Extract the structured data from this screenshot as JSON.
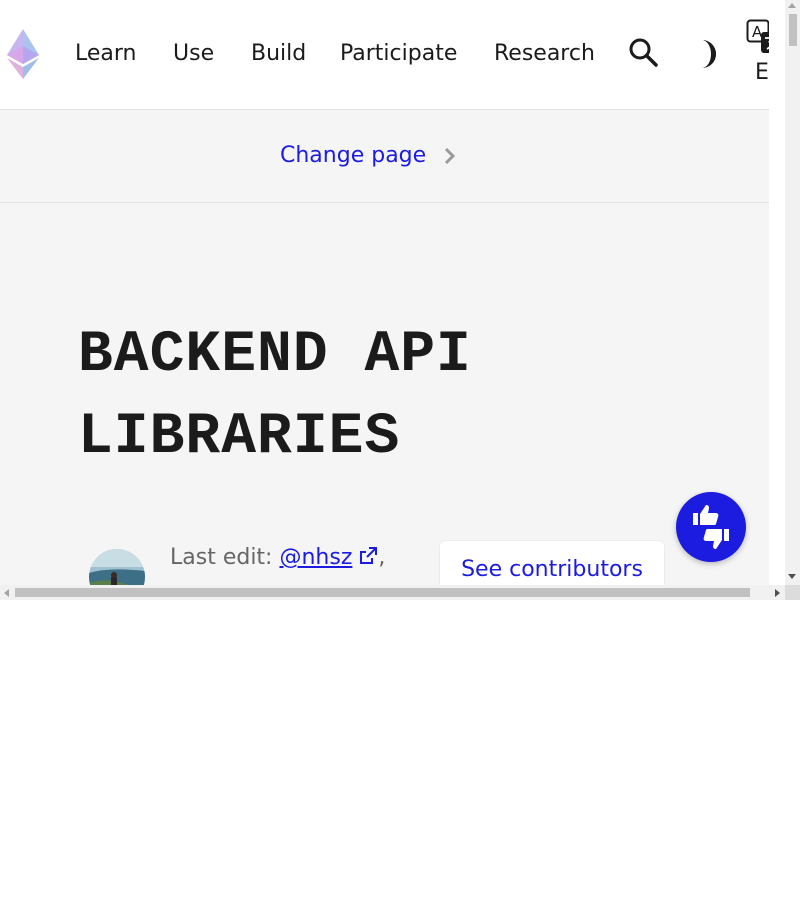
{
  "header": {
    "logo": {
      "icon": "ethereum-logo-icon"
    },
    "nav": [
      {
        "label": "Learn"
      },
      {
        "label": "Use"
      },
      {
        "label": "Build"
      },
      {
        "label": "Participate"
      },
      {
        "label": "Research"
      }
    ],
    "search_icon": "search-icon",
    "theme_icon": "dark-mode-icon",
    "language": {
      "icon": "translate-icon",
      "label": "EN"
    }
  },
  "change_page": {
    "label": "Change page",
    "icon": "chevron-right-icon"
  },
  "hero": {
    "title_line1": "BACKEND API",
    "title_line2": "LIBRARIES",
    "last_edit": {
      "prefix": "Last edit: ",
      "user": "@nhsz",
      "suffix": ","
    },
    "contributors_button": "See contributors",
    "feedback_icon": "thumbs-up-down-icon"
  },
  "colors": {
    "link": "#1c1ce1",
    "text": "#1b1b1b",
    "muted": "#666666",
    "bar_background": "#f5f5f5",
    "feedback_button": "#1c1ce1"
  }
}
